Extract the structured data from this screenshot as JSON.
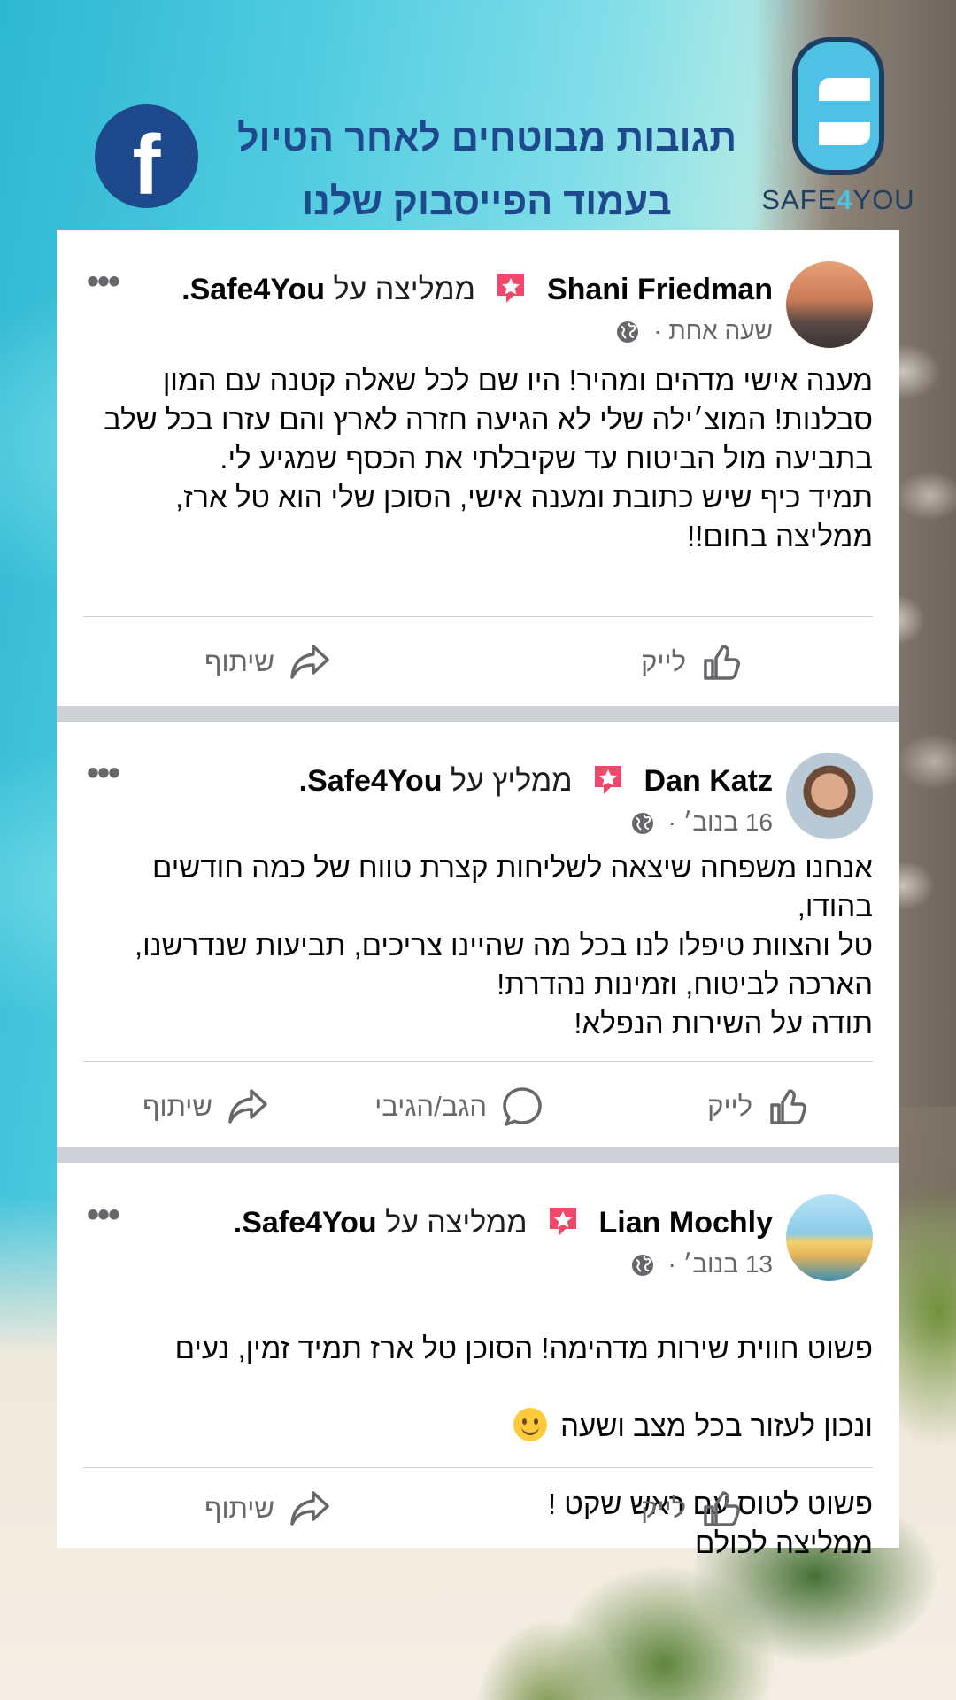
{
  "header": {
    "headline_line1": "תגובות מבוטחים לאחר הטיול",
    "headline_line2": "בעמוד הפייסבוק שלנו",
    "facebook_glyph": "f",
    "brand_name_a": "SAFE",
    "brand_name_b": "4",
    "brand_name_c": "YOU"
  },
  "posts": [
    {
      "author": "Shani Friedman",
      "recommends": "ממליצה על",
      "page": "Safe4You.",
      "time": "שעה אחת",
      "separator": "·",
      "text": "מענה אישי מדהים ומהיר! היו שם לכל שאלה קטנה עם המון סבלנות! המוצ׳ילה שלי לא הגיעה חזרה לארץ והם עזרו בכל שלב בתביעה מול הביטוח  עד שקיבלתי את הכסף שמגיע לי.\nתמיד כיף שיש כתובת ומענה אישי, הסוכן שלי הוא טל ארז, ממליצה בחום!!",
      "actions": {
        "like": "לייק",
        "share": "שיתוף"
      }
    },
    {
      "author": "Dan Katz",
      "recommends": "ממליץ על",
      "page": "Safe4You.",
      "time": "16 בנוב׳",
      "separator": "·",
      "text": "אנחנו משפחה שיצאה לשליחות קצרת טווח של כמה חודשים בהודו,\nטל והצוות טיפלו לנו בכל מה שהיינו צריכים, תביעות שנדרשנו, הארכה לביטוח, וזמינות נהדרת!\nתודה על השירות הנפלא!",
      "actions": {
        "like": "לייק",
        "comment": "הגב/הגיבי",
        "share": "שיתוף"
      }
    },
    {
      "author": "Lian Mochly",
      "recommends": "ממליצה על",
      "page": "Safe4You.",
      "time": "13 בנוב׳",
      "separator": "·",
      "text_line1": "פשוט חווית שירות מדהימה! הסוכן טל ארז תמיד זמין, נעים",
      "text_line2": "ונכון לעזור בכל מצב ושעה",
      "text_rest": "פשוט לטוס  עם ראש שקט !\nממליצה לכולם",
      "actions": {
        "like": "לייק",
        "share": "שיתוף"
      }
    }
  ],
  "colors": {
    "facebook_blue": "#1e4a8d",
    "brand_cyan": "#4ec1e4",
    "brand_navy": "#1f3e63",
    "recommend_badge": "#f0486a",
    "secondary_text": "#65676b"
  },
  "icons": [
    "facebook-logo-icon",
    "recommend-badge-icon",
    "globe-icon",
    "more-options-icon",
    "like-thumb-icon",
    "comment-bubble-icon",
    "share-arrow-icon",
    "smiley-emoji-icon"
  ]
}
